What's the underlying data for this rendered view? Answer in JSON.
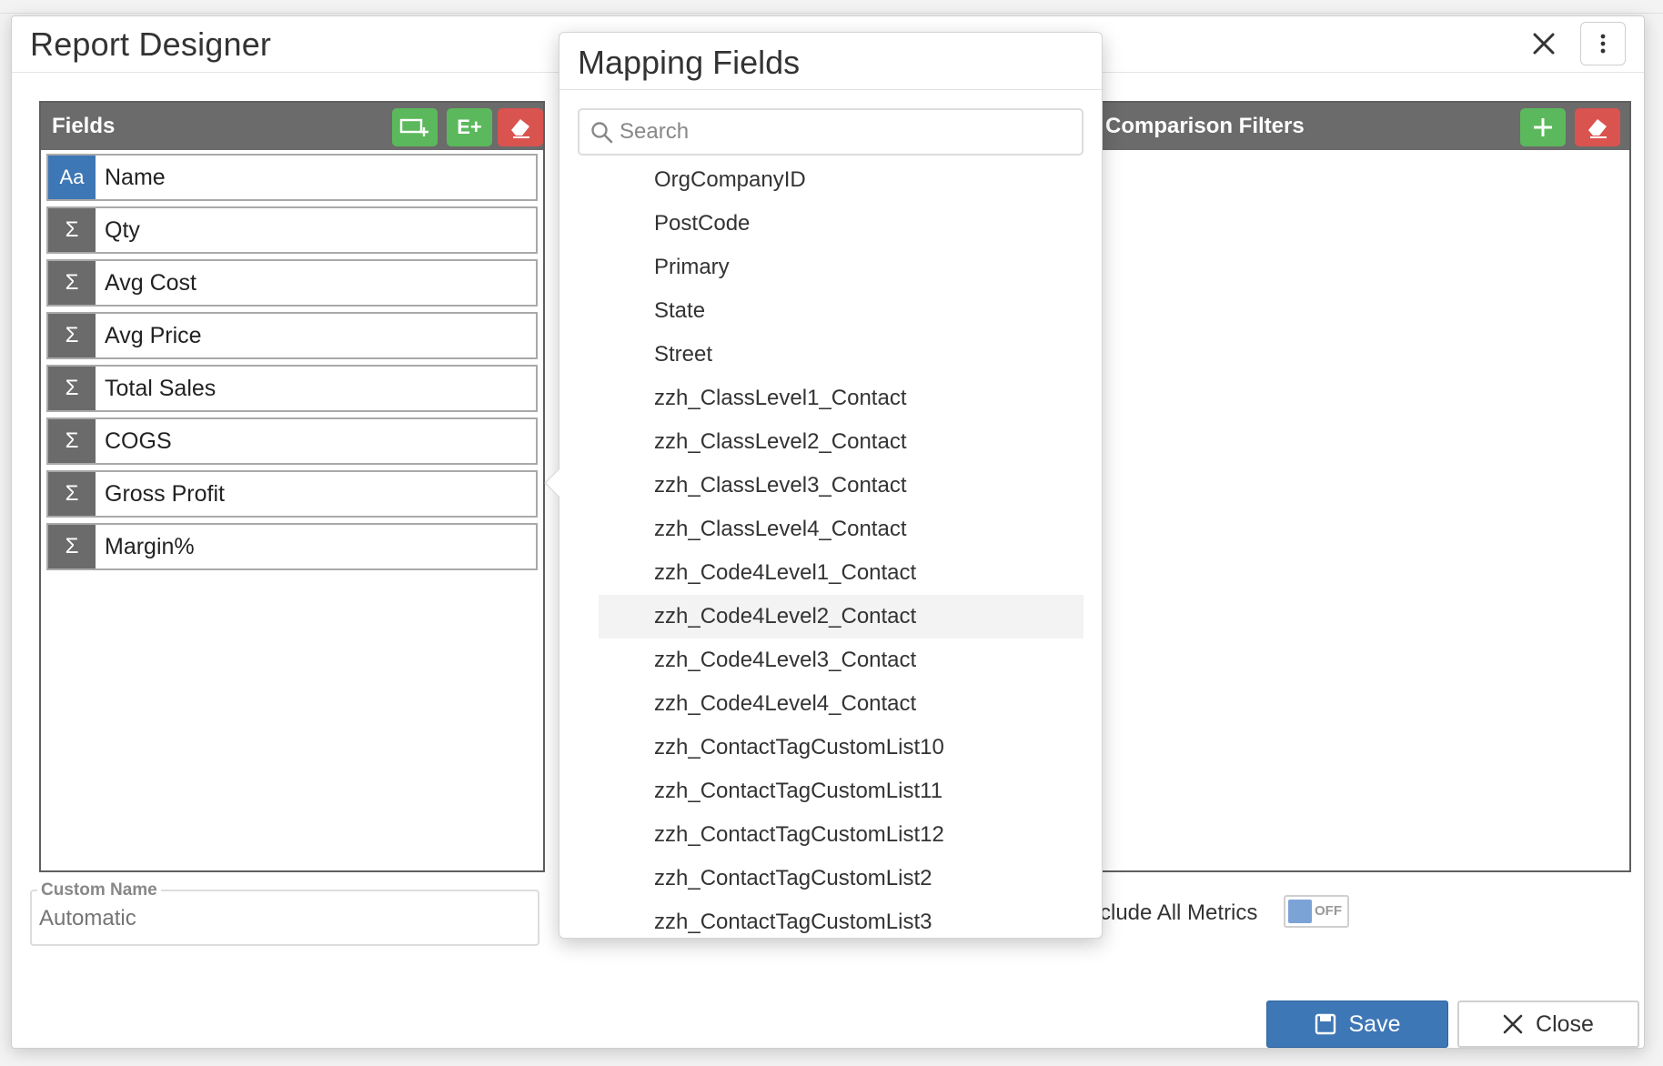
{
  "dialog": {
    "title": "Report Designer"
  },
  "fields_panel": {
    "title": "Fields",
    "add_field_label": "E+",
    "items": [
      {
        "type": "text",
        "type_glyph": "Aa",
        "label": "Name"
      },
      {
        "type": "measure",
        "type_glyph": "Σ",
        "label": "Qty"
      },
      {
        "type": "measure",
        "type_glyph": "Σ",
        "label": "Avg Cost"
      },
      {
        "type": "measure",
        "type_glyph": "Σ",
        "label": "Avg Price"
      },
      {
        "type": "measure",
        "type_glyph": "Σ",
        "label": "Total Sales"
      },
      {
        "type": "measure",
        "type_glyph": "Σ",
        "label": "COGS"
      },
      {
        "type": "measure",
        "type_glyph": "Σ",
        "label": "Gross Profit"
      },
      {
        "type": "measure",
        "type_glyph": "Σ",
        "label": "Margin%"
      }
    ]
  },
  "comparison_panel": {
    "title": "Comparison Filters"
  },
  "custom_name": {
    "label": "Custom Name",
    "placeholder": "Automatic"
  },
  "include_metrics": {
    "label": "clude All Metrics",
    "toggle_text": "OFF"
  },
  "buttons": {
    "save": "Save",
    "close": "Close"
  },
  "popover": {
    "title": "Mapping Fields",
    "search_placeholder": "Search",
    "options": [
      "OrgCompanyID",
      "PostCode",
      "Primary",
      "State",
      "Street",
      "zzh_ClassLevel1_Contact",
      "zzh_ClassLevel2_Contact",
      "zzh_ClassLevel3_Contact",
      "zzh_ClassLevel4_Contact",
      "zzh_Code4Level1_Contact",
      "zzh_Code4Level2_Contact",
      "zzh_Code4Level3_Contact",
      "zzh_Code4Level4_Contact",
      "zzh_ContactTagCustomList10",
      "zzh_ContactTagCustomList11",
      "zzh_ContactTagCustomList12",
      "zzh_ContactTagCustomList2",
      "zzh_ContactTagCustomList3"
    ],
    "highlighted_option": "zzh_Code4Level2_Contact"
  },
  "colors": {
    "primary": "#3e77b5",
    "success": "#5cb85c",
    "danger": "#d9534f",
    "panel_header": "#6b6b6b"
  }
}
